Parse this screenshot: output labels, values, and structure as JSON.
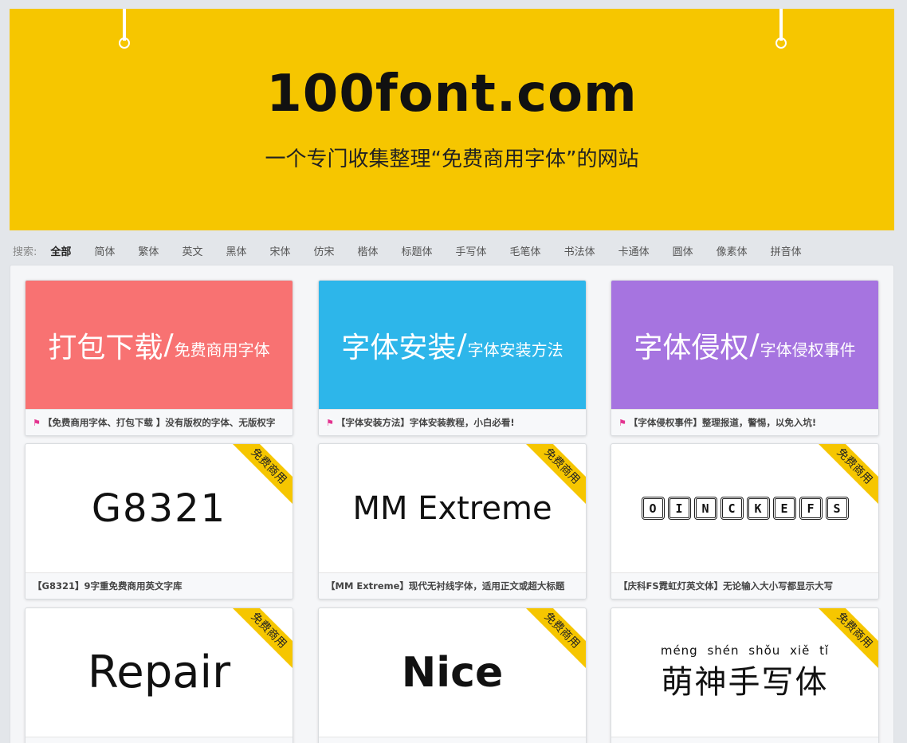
{
  "banner": {
    "title": "100font.com",
    "subtitle": "一个专门收集整理“免费商用字体”的网站"
  },
  "filter": {
    "label": "搜索:",
    "items": [
      "全部",
      "简体",
      "繁体",
      "英文",
      "黑体",
      "宋体",
      "仿宋",
      "楷体",
      "标题体",
      "手写体",
      "毛笔体",
      "书法体",
      "卡通体",
      "圆体",
      "像素体",
      "拼音体"
    ],
    "active": "全部"
  },
  "categories": [
    {
      "big": "打包下载",
      "small": "免费商用字体",
      "color": "#f87272",
      "caption": "【免费商用字体、打包下载 】没有版权的字体、无版权字"
    },
    {
      "big": "字体安装",
      "small": "字体安装方法",
      "color": "#2db6ea",
      "caption": "【字体安装方法】字体安装教程，小白必看!"
    },
    {
      "big": "字体侵权",
      "small": "字体侵权事件",
      "color": "#a674e0",
      "caption": "【字体侵权事件】整理报道，警惕，以免入坑!"
    }
  ],
  "ribbon_label": "免费商用",
  "fonts": [
    {
      "specimen": "G8321",
      "caption": "【G8321】9字重免费商用英文字库"
    },
    {
      "specimen": "MM Extreme",
      "caption": "【MM Extreme】现代无衬线字体，适用正文或超大标题"
    },
    {
      "specimen": "OINCKEFS",
      "caption": "【庆科FS霓虹灯英文体】无论输入大小写都显示大写"
    },
    {
      "specimen": "Repair",
      "caption": ""
    },
    {
      "specimen": "Nice",
      "caption": ""
    },
    {
      "specimen_pinyin": "méng shén shǒu xiě tǐ",
      "specimen": "萌神手写体",
      "caption": ""
    }
  ],
  "colors": {
    "banner": "#f6c600",
    "ribbon": "#f6c600",
    "flag": "#e3338f"
  }
}
